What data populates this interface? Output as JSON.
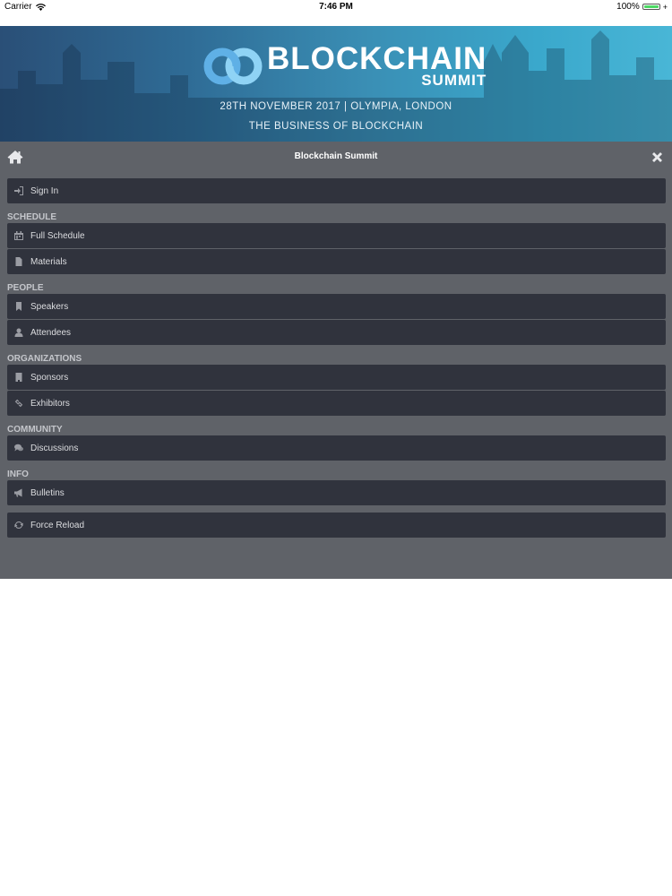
{
  "status_bar": {
    "carrier": "Carrier",
    "time": "7:46 PM",
    "battery": "100%",
    "battery_level": 1.0
  },
  "banner": {
    "logo_title": "BLOCKCHAIN",
    "logo_subtitle": "SUMMIT",
    "date_location": "28TH NOVEMBER 2017  |  OLYMPIA, LONDON",
    "tagline": "THE BUSINESS OF BLOCKCHAIN",
    "colors": {
      "gradient_start": "#2a4f77",
      "gradient_end": "#49b6d6"
    }
  },
  "menu": {
    "title": "Blockchain Summit",
    "background": "#5f6268",
    "item_background": "#30333d",
    "sign_in": {
      "label": "Sign In",
      "icon": "sign-in-icon"
    },
    "sections": {
      "schedule": {
        "label": "SCHEDULE",
        "items": [
          {
            "label": "Full Schedule",
            "icon": "calendar-icon"
          },
          {
            "label": "Materials",
            "icon": "file-icon"
          }
        ]
      },
      "people": {
        "label": "PEOPLE",
        "items": [
          {
            "label": "Speakers",
            "icon": "bookmark-icon"
          },
          {
            "label": "Attendees",
            "icon": "user-icon"
          }
        ]
      },
      "organizations": {
        "label": "ORGANIZATIONS",
        "items": [
          {
            "label": "Sponsors",
            "icon": "building-icon"
          },
          {
            "label": "Exhibitors",
            "icon": "link-icon"
          }
        ]
      },
      "community": {
        "label": "COMMUNITY",
        "items": [
          {
            "label": "Discussions",
            "icon": "comments-icon"
          }
        ]
      },
      "info": {
        "label": "INFO",
        "items": [
          {
            "label": "Bulletins",
            "icon": "bullhorn-icon"
          }
        ]
      }
    },
    "force_reload": {
      "label": "Force Reload",
      "icon": "refresh-icon"
    }
  }
}
